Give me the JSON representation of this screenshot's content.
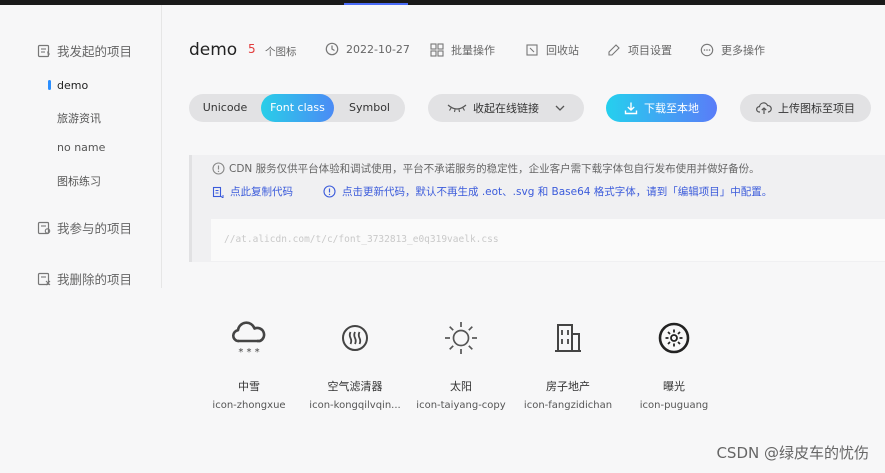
{
  "sidebar": {
    "groups": [
      {
        "label": "我发起的项目",
        "icon": "project-doc-icon"
      },
      {
        "label": "我参与的项目",
        "icon": "project-join-icon"
      },
      {
        "label": "我删除的项目",
        "icon": "project-deleted-icon"
      }
    ],
    "projects": [
      "demo",
      "旅游资讯",
      "no name",
      "图标练习"
    ],
    "active_project": "demo"
  },
  "header": {
    "title": "demo",
    "count": "5",
    "count_label": "个图标",
    "date": "2022-10-27",
    "batch": "批量操作",
    "trash": "回收站",
    "settings": "项目设置",
    "more": "更多操作"
  },
  "toolbar": {
    "tabs": [
      "Unicode",
      "Font class",
      "Symbol"
    ],
    "active_tab": "Font class",
    "collapse_label": "收起在线链接",
    "download_label": "下载至本地",
    "upload_label": "上传图标至项目"
  },
  "notice": {
    "text": "CDN 服务仅供平台体验和调试使用，平台不承诺服务的稳定性，企业客户需下载字体包自行发布使用并做好备份。",
    "copy_link": "点此复制代码",
    "update_link": "点击更新代码，默认不再生成 .eot、.svg 和 Base64 格式字体，请到「编辑项目」中配置。",
    "code": "//at.alicdn.com/t/c/font_3732813_e0q319vaelk.css"
  },
  "icons": [
    {
      "name": "中雪",
      "code": "icon-zhongxue",
      "glyph": "snow-cloud-icon"
    },
    {
      "name": "空气滤清器",
      "code": "icon-kongqilvqin...",
      "glyph": "air-filter-icon"
    },
    {
      "name": "太阳",
      "code": "icon-taiyang-copy",
      "glyph": "sun-icon"
    },
    {
      "name": "房子地产",
      "code": "icon-fangzidichan",
      "glyph": "building-icon"
    },
    {
      "name": "曝光",
      "code": "icon-puguang",
      "glyph": "exposure-icon"
    }
  ],
  "watermark": "CSDN @绿皮车的忧伤",
  "colors": {
    "accent": "#4b8bf5",
    "cyan": "#29cee8",
    "count": "#e23d3d",
    "link": "#3b5bdb"
  }
}
